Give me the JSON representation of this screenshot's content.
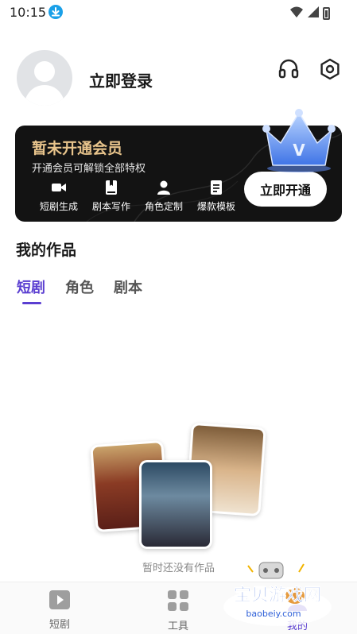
{
  "status_bar": {
    "time": "10:15"
  },
  "profile": {
    "login_label": "立即登录"
  },
  "vip": {
    "title": "暂未开通会员",
    "subtitle": "开通会员可解锁全部特权",
    "features": [
      {
        "label": "短剧生成",
        "icon": "video-camera-icon"
      },
      {
        "label": "剧本写作",
        "icon": "book-icon"
      },
      {
        "label": "角色定制",
        "icon": "person-icon"
      },
      {
        "label": "爆款模板",
        "icon": "document-icon"
      }
    ],
    "button_label": "立即开通",
    "crown_letter": "V"
  },
  "works": {
    "title": "我的作品",
    "tabs": [
      "短剧",
      "角色",
      "剧本"
    ],
    "active_tab": 0,
    "empty_text": "暂时还没有作品"
  },
  "bottom_nav": {
    "items": [
      {
        "label": "短剧",
        "icon": "play-icon"
      },
      {
        "label": "工具",
        "icon": "grid-icon"
      },
      {
        "label": "我的",
        "icon": "user-icon"
      }
    ]
  },
  "watermark": {
    "title": "宝贝游戏网",
    "url": "baobeiy.com"
  },
  "colors": {
    "accent": "#5b3fd1",
    "vip_gold": "#e8c48c",
    "vip_bg": "#131313"
  }
}
